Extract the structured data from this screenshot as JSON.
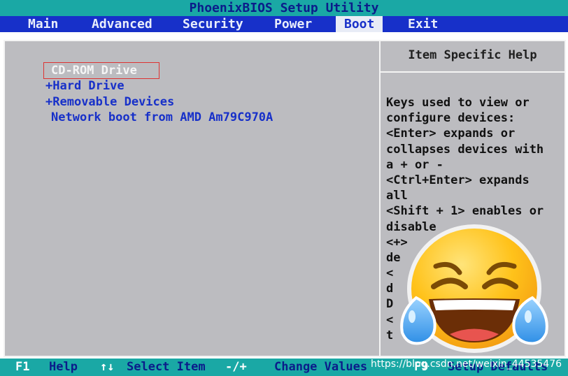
{
  "window": {
    "title": "PhoenixBIOS Setup Utility"
  },
  "menu": {
    "items": [
      {
        "label": "Main"
      },
      {
        "label": "Advanced"
      },
      {
        "label": "Security"
      },
      {
        "label": "Power"
      },
      {
        "label": "Boot",
        "active": true
      },
      {
        "label": "Exit"
      }
    ]
  },
  "boot_order": [
    {
      "prefix": "",
      "label": "CD-ROM Drive",
      "selected": true
    },
    {
      "prefix": "+",
      "label": "Hard Drive"
    },
    {
      "prefix": "+",
      "label": "Removable Devices"
    },
    {
      "prefix": "",
      "label": "Network boot from AMD Am79C970A"
    }
  ],
  "help": {
    "title": "Item Specific Help",
    "lines": [
      "Keys used to view or",
      "configure devices:",
      "<Enter> expands or",
      "collapses devices with",
      "a + or -",
      "<Ctrl+Enter> expands",
      "all",
      "<Shift + 1> enables or",
      "disable",
      "<+>",
      "de",
      "<",
      "d",
      "D",
      "<",
      "t"
    ]
  },
  "status_bar": {
    "items": [
      {
        "key": "F1",
        "desc": "Help"
      },
      {
        "key": "↑↓",
        "desc": "Select Item"
      },
      {
        "key": "-/+",
        "desc": "Change Values"
      },
      {
        "key": "F9",
        "desc": "Setup Defaults"
      }
    ]
  },
  "watermark": "https://blog.csdn.net/weixin_44535476",
  "overlay": {
    "name": "tears-of-joy-emoji"
  },
  "colors": {
    "title_bar": "#1aa8a5",
    "menu_bar": "#1730c9",
    "panel": "#bcbcc0",
    "item_text": "#1730c9",
    "selected_border": "#dd3333"
  }
}
